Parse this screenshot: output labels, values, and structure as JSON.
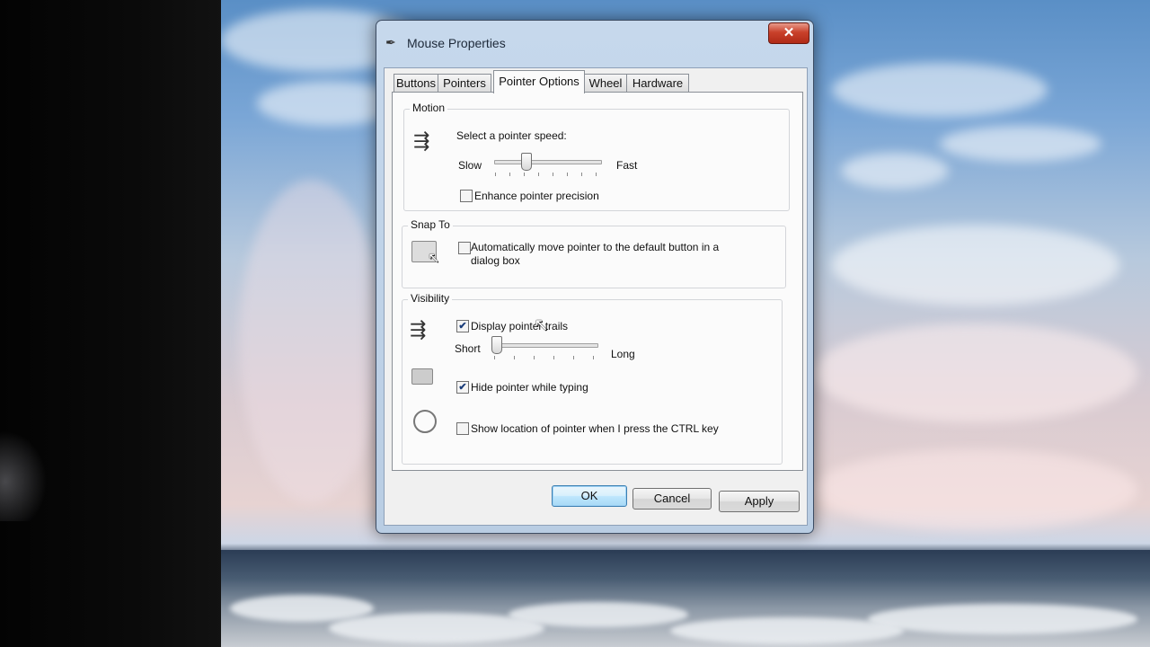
{
  "window": {
    "title": "Mouse Properties",
    "close_symbol": "✕"
  },
  "tabs": [
    {
      "label": "Buttons"
    },
    {
      "label": "Pointers"
    },
    {
      "label": "Pointer Options"
    },
    {
      "label": "Wheel"
    },
    {
      "label": "Hardware"
    }
  ],
  "motion": {
    "group_title": "Motion",
    "speed_label": "Select a pointer speed:",
    "slow_label": "Slow",
    "fast_label": "Fast",
    "speed_level": 0.3,
    "enhance_label": "Enhance pointer precision",
    "enhance_checked": false
  },
  "snap_to": {
    "group_title": "Snap To",
    "auto_move_label_line1": "Automatically move pointer to the default button in a",
    "auto_move_label_line2": "dialog box",
    "auto_move_checked": false
  },
  "visibility": {
    "group_title": "Visibility",
    "trails_label": "Display pointer trails",
    "trails_checked": true,
    "short_label": "Short",
    "long_label": "Long",
    "trail_level": 0.0,
    "hide_label": "Hide pointer while typing",
    "hide_checked": true,
    "show_location_label": "Show location of pointer when I press the CTRL key",
    "show_location_checked": false
  },
  "buttons": {
    "ok": "OK",
    "cancel": "Cancel",
    "apply": "Apply"
  },
  "icons": {
    "title_icon": "mouse-icon",
    "motion_icon": "pointer-speed-icon",
    "snap_icon": "snap-to-icon",
    "trails_icon": "pointer-trails-icon",
    "hide_icon": "hide-pointer-icon",
    "location_icon": "pointer-location-icon"
  },
  "colors": {
    "close_button": "#c9412b",
    "default_button_border": "#3c7fb1",
    "checkbox_mark": "#1a3d7a"
  }
}
